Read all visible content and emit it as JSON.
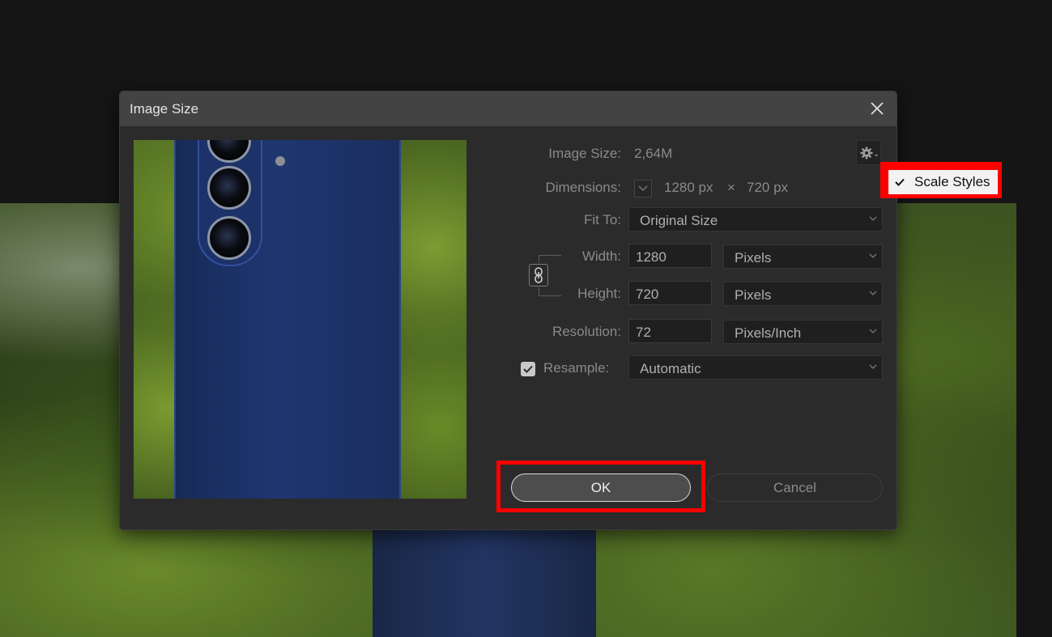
{
  "dialog": {
    "title": "Image Size"
  },
  "info": {
    "image_size_label": "Image Size:",
    "image_size_value": "2,64M",
    "dimensions_label": "Dimensions:",
    "dim_width": "1280 px",
    "dim_times": "×",
    "dim_height": "720 px"
  },
  "fit_to": {
    "label": "Fit To:",
    "value": "Original Size"
  },
  "width": {
    "label": "Width:",
    "value": "1280",
    "unit": "Pixels"
  },
  "height": {
    "label": "Height:",
    "value": "720",
    "unit": "Pixels"
  },
  "resolution": {
    "label": "Resolution:",
    "value": "72",
    "unit": "Pixels/Inch"
  },
  "resample": {
    "label": "Resample:",
    "checked": true,
    "value": "Automatic"
  },
  "buttons": {
    "ok": "OK",
    "cancel": "Cancel"
  },
  "settings_menu": {
    "item": "Scale Styles",
    "checked": true
  },
  "colors": {
    "highlight": "#ff0000"
  }
}
